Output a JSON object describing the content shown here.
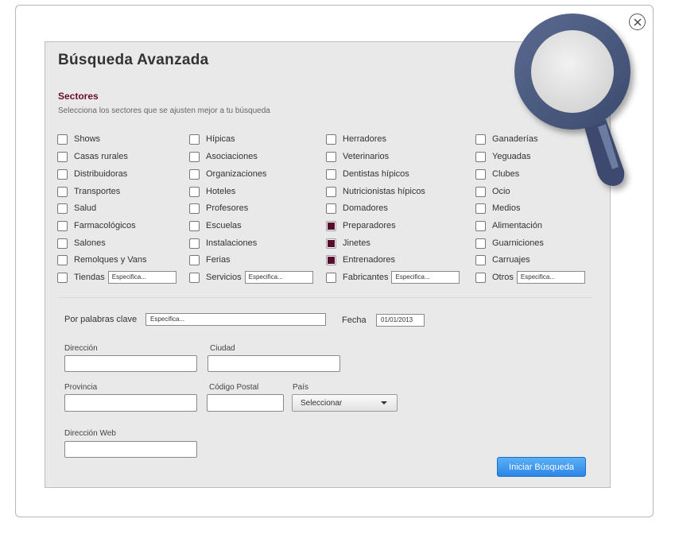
{
  "modal": {
    "title": "Búsqueda Avanzada",
    "section_title": "Sectores",
    "section_desc": "Selecciona los sectores que se ajusten mejor a tu búsqueda"
  },
  "sectors": {
    "col1": [
      {
        "label": "Shows",
        "checked": false
      },
      {
        "label": "Casas rurales",
        "checked": false
      },
      {
        "label": "Distribuidoras",
        "checked": false
      },
      {
        "label": "Transportes",
        "checked": false
      },
      {
        "label": "Salud",
        "checked": false
      },
      {
        "label": "Farmacológicos",
        "checked": false
      },
      {
        "label": "Salones",
        "checked": false
      },
      {
        "label": "Remolques y Vans",
        "checked": false
      },
      {
        "label": "Tiendas",
        "checked": false,
        "placeholder": "Especifica..."
      }
    ],
    "col2": [
      {
        "label": "Hípicas",
        "checked": false
      },
      {
        "label": "Asociaciones",
        "checked": false
      },
      {
        "label": "Organizaciones",
        "checked": false
      },
      {
        "label": "Hoteles",
        "checked": false
      },
      {
        "label": "Profesores",
        "checked": false
      },
      {
        "label": "Escuelas",
        "checked": false
      },
      {
        "label": "Instalaciones",
        "checked": false
      },
      {
        "label": "Ferias",
        "checked": false
      },
      {
        "label": "Servicios",
        "checked": false,
        "placeholder": "Especifica..."
      }
    ],
    "col3": [
      {
        "label": "Herradores",
        "checked": false
      },
      {
        "label": "Veterinarios",
        "checked": false
      },
      {
        "label": "Dentistas hípicos",
        "checked": false
      },
      {
        "label": "Nutricionistas hípicos",
        "checked": false
      },
      {
        "label": "Domadores",
        "checked": false
      },
      {
        "label": "Preparadores",
        "checked": true
      },
      {
        "label": "Jinetes",
        "checked": true
      },
      {
        "label": "Entrenadores",
        "checked": true
      },
      {
        "label": "Fabricantes",
        "checked": false,
        "placeholder": "Especifica..."
      }
    ],
    "col4": [
      {
        "label": "Ganaderías",
        "checked": false
      },
      {
        "label": "Yeguadas",
        "checked": false
      },
      {
        "label": "Clubes",
        "checked": false
      },
      {
        "label": "Ocio",
        "checked": false
      },
      {
        "label": "Medios",
        "checked": false
      },
      {
        "label": "Alimentación",
        "checked": false
      },
      {
        "label": "Guarniciones",
        "checked": false
      },
      {
        "label": "Carruajes",
        "checked": false
      },
      {
        "label": "Otros",
        "checked": false,
        "placeholder": "Especifica..."
      }
    ]
  },
  "form": {
    "keywords_label": "Por palabras clave",
    "keywords_placeholder": "Especifica...",
    "date_label": "Fecha",
    "date_value": "01/01/2013",
    "address_label": "Dirección",
    "city_label": "Ciudad",
    "province_label": "Provincia",
    "postal_label": "Código Postal",
    "country_label": "País",
    "country_select": "Seleccionar",
    "web_label": "Dirección Web",
    "submit_label": "Iniciar Búsqueda"
  },
  "colors": {
    "accent": "#6a0e2c",
    "button": "#2c86e6"
  }
}
